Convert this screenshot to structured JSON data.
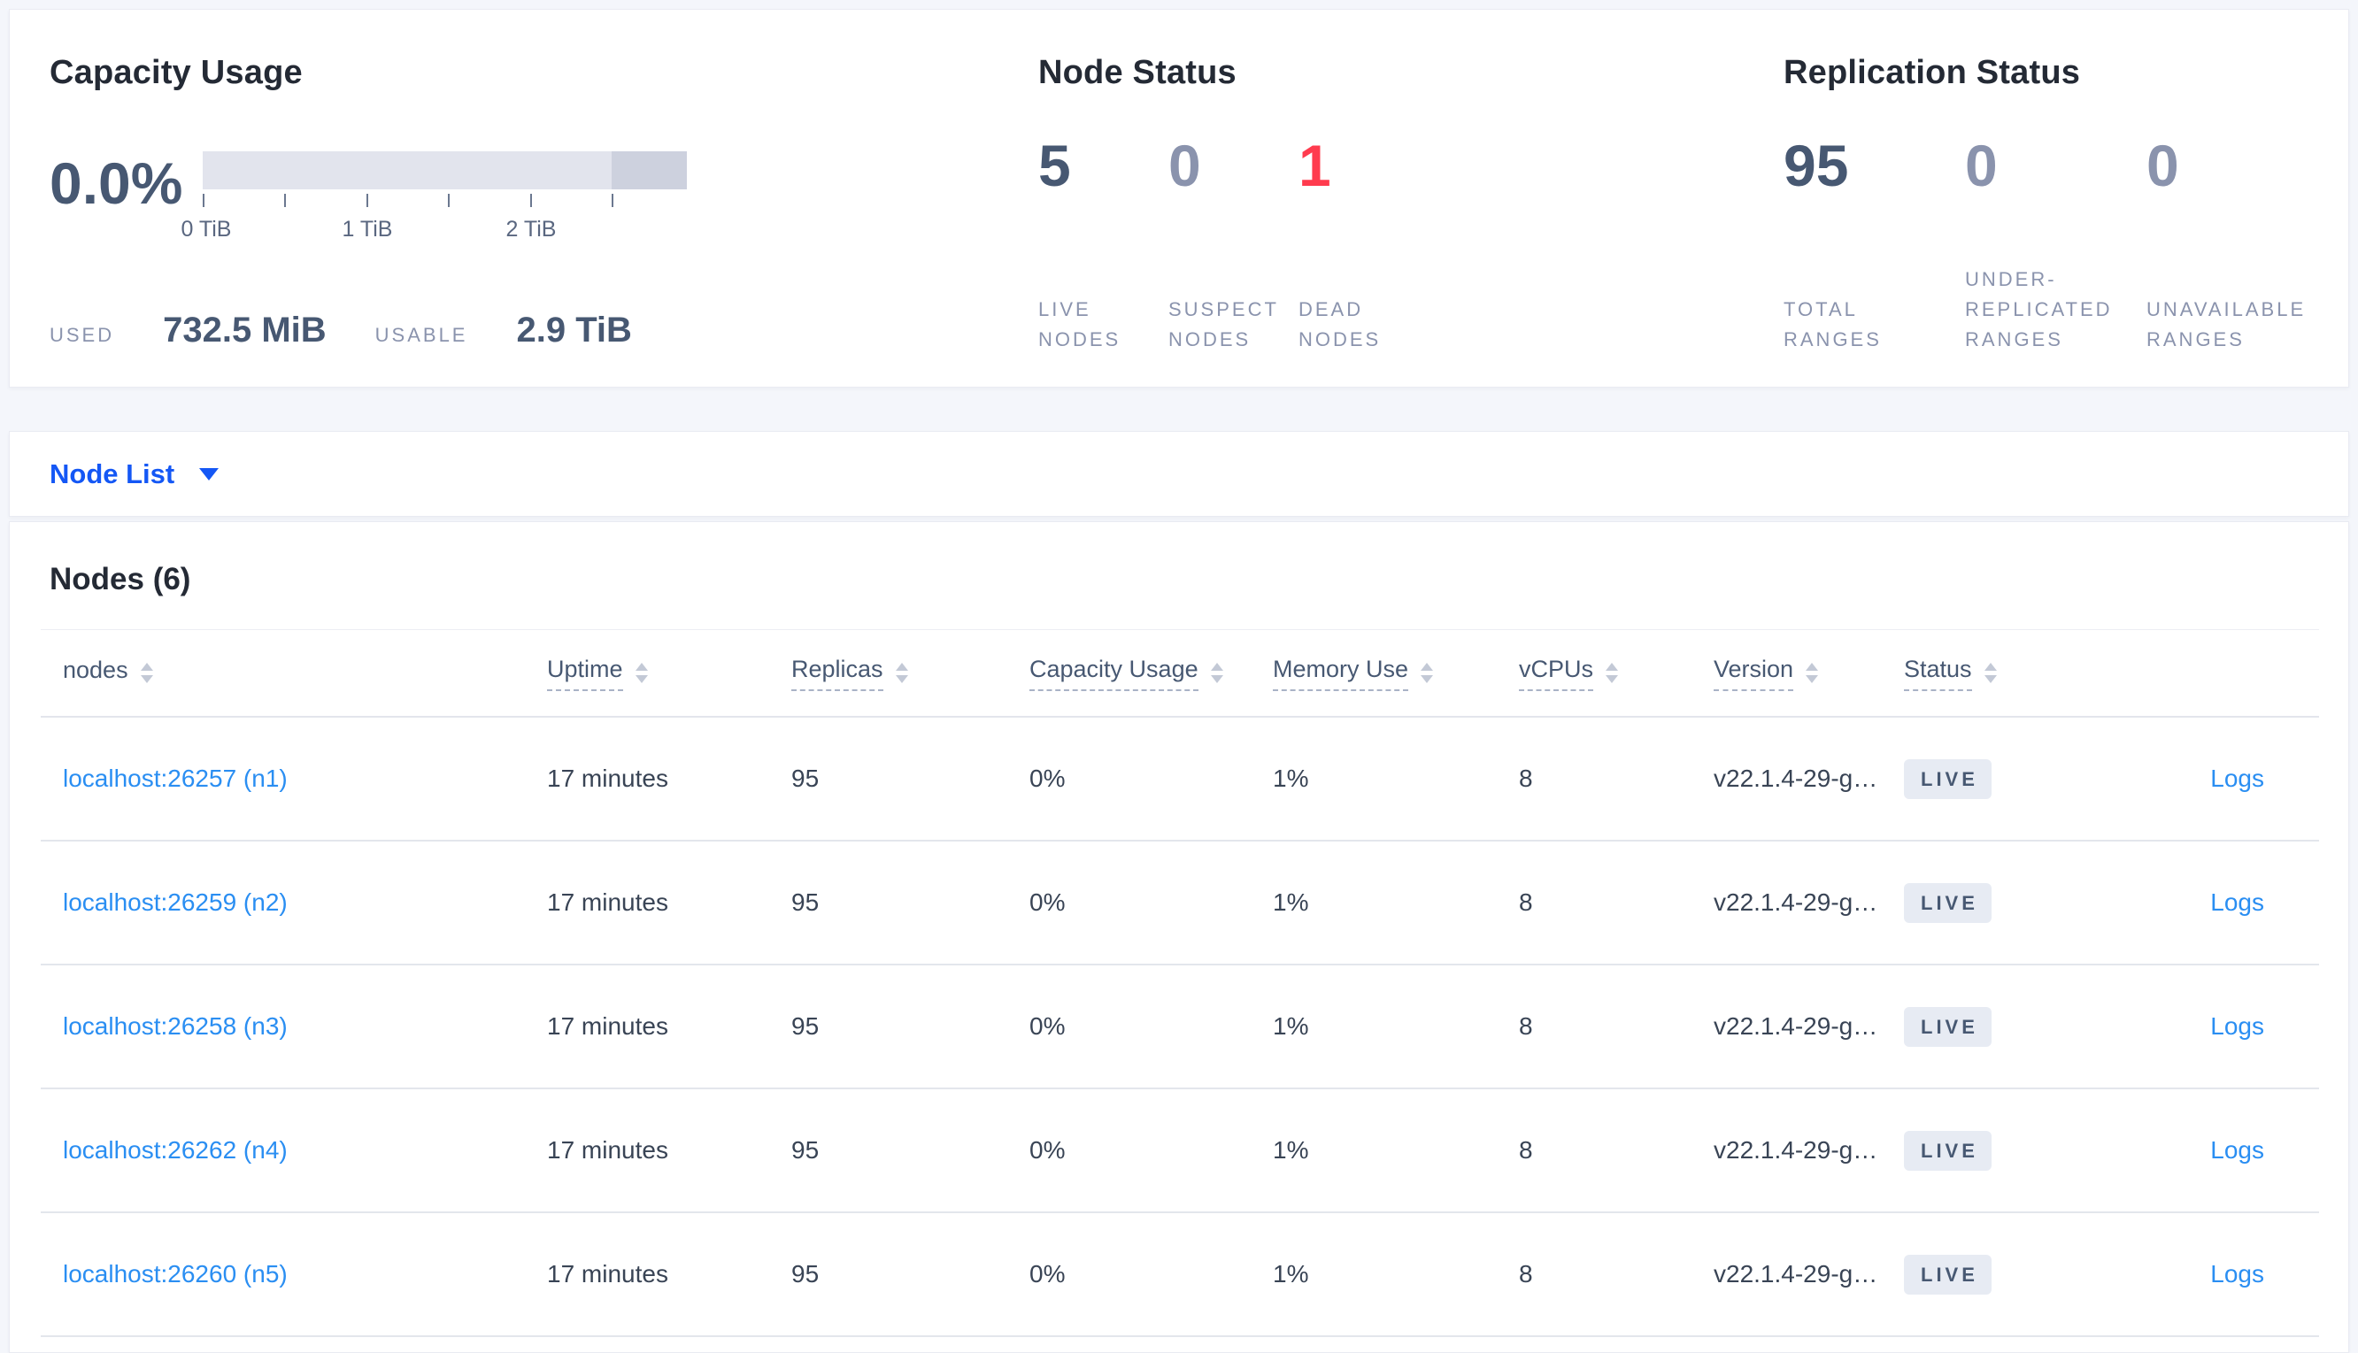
{
  "colors": {
    "page_bg": "#f4f6fb",
    "accent_blue": "#1457f5",
    "link_blue": "#2a8ef2",
    "dead_red": "#ff3b4e",
    "stat_dark": "#475872",
    "stat_muted": "#8a93ad",
    "badge_bg": "#e7ebf3",
    "capacity_bar_light": "#e2e4ed",
    "capacity_bar_dark": "#cdd1de"
  },
  "summary": {
    "capacity": {
      "title": "Capacity Usage",
      "percent": "0.0%",
      "used_label": "USED",
      "used_value": "732.5 MiB",
      "usable_label": "USABLE",
      "usable_value": "2.9 TiB",
      "axis_tick_labels": [
        "0 TiB",
        "1 TiB",
        "2 TiB"
      ]
    },
    "node_status": {
      "title": "Node Status",
      "stats": [
        {
          "value": "5",
          "label": "LIVE NODES"
        },
        {
          "value": "0",
          "label": "SUSPECT NODES"
        },
        {
          "value": "1",
          "label": "DEAD NODES"
        }
      ]
    },
    "replication_status": {
      "title": "Replication Status",
      "stats": [
        {
          "value": "95",
          "label": "TOTAL RANGES"
        },
        {
          "value": "0",
          "label": "UNDER-REPLICATED RANGES"
        },
        {
          "value": "0",
          "label": "UNAVAILABLE RANGES"
        }
      ]
    }
  },
  "view_selector": {
    "label": "Node List"
  },
  "nodes_section": {
    "title": "Nodes (6)",
    "columns": [
      {
        "label": "nodes"
      },
      {
        "label": "Uptime"
      },
      {
        "label": "Replicas"
      },
      {
        "label": "Capacity Usage"
      },
      {
        "label": "Memory Use"
      },
      {
        "label": "vCPUs"
      },
      {
        "label": "Version"
      },
      {
        "label": "Status"
      }
    ],
    "rows": [
      {
        "node": "localhost:26257 (n1)",
        "uptime": "17 minutes",
        "replicas": "95",
        "capacity_usage": "0%",
        "memory_use": "1%",
        "vcpus": "8",
        "version": "v22.1.4-29-g…",
        "status": "LIVE",
        "logs_label": "Logs"
      },
      {
        "node": "localhost:26259 (n2)",
        "uptime": "17 minutes",
        "replicas": "95",
        "capacity_usage": "0%",
        "memory_use": "1%",
        "vcpus": "8",
        "version": "v22.1.4-29-g…",
        "status": "LIVE",
        "logs_label": "Logs"
      },
      {
        "node": "localhost:26258 (n3)",
        "uptime": "17 minutes",
        "replicas": "95",
        "capacity_usage": "0%",
        "memory_use": "1%",
        "vcpus": "8",
        "version": "v22.1.4-29-g…",
        "status": "LIVE",
        "logs_label": "Logs"
      },
      {
        "node": "localhost:26262 (n4)",
        "uptime": "17 minutes",
        "replicas": "95",
        "capacity_usage": "0%",
        "memory_use": "1%",
        "vcpus": "8",
        "version": "v22.1.4-29-g…",
        "status": "LIVE",
        "logs_label": "Logs"
      },
      {
        "node": "localhost:26260 (n5)",
        "uptime": "17 minutes",
        "replicas": "95",
        "capacity_usage": "0%",
        "memory_use": "1%",
        "vcpus": "8",
        "version": "v22.1.4-29-g…",
        "status": "LIVE",
        "logs_label": "Logs"
      }
    ]
  }
}
